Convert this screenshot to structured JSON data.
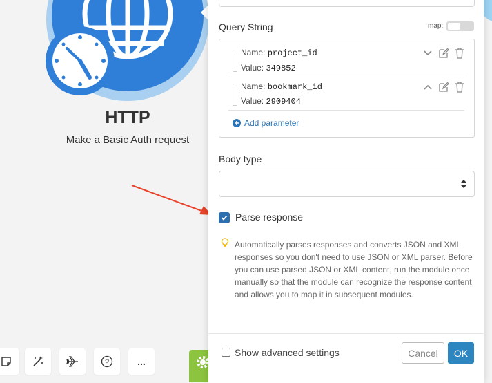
{
  "module": {
    "title": "HTTP",
    "subtitle": "Make a Basic Auth request"
  },
  "panel": {
    "query_string_label": "Query String",
    "map_label": "map:",
    "params": [
      {
        "name_label": "Name:",
        "name": "project_id",
        "value_label": "Value:",
        "value": "349852",
        "collapse_icon": "chevron-down-icon"
      },
      {
        "name_label": "Name:",
        "name": "bookmark_id",
        "value_label": "Value:",
        "value": "2909404",
        "collapse_icon": "chevron-up-icon"
      }
    ],
    "add_parameter": "Add parameter",
    "body_type_label": "Body type",
    "body_type_value": "",
    "parse_response_label": "Parse response",
    "parse_response_checked": true,
    "help_text": "Automatically parses responses and converts JSON and XML responses so you don't need to use JSON or XML parser. Before you can use parsed JSON or XML content, run the module once manually so that the module can recognize the response content and allows you to map it in subsequent modules.",
    "show_advanced_label": "Show advanced settings",
    "cancel_label": "Cancel",
    "ok_label": "OK"
  },
  "toolbar": {
    "more_label": "...",
    "question_label": "?",
    "colors": {
      "green": "#8cc43f",
      "purple": "#a98ad8",
      "red": "#e0674f",
      "pink": "#c2356a",
      "blue": "#2e6fd8",
      "sky": "#5aaee9"
    }
  },
  "colors": {
    "accent": "#2c6fb0",
    "ok_button": "#2e86c1",
    "annotation_arrow": "#e8432b"
  }
}
